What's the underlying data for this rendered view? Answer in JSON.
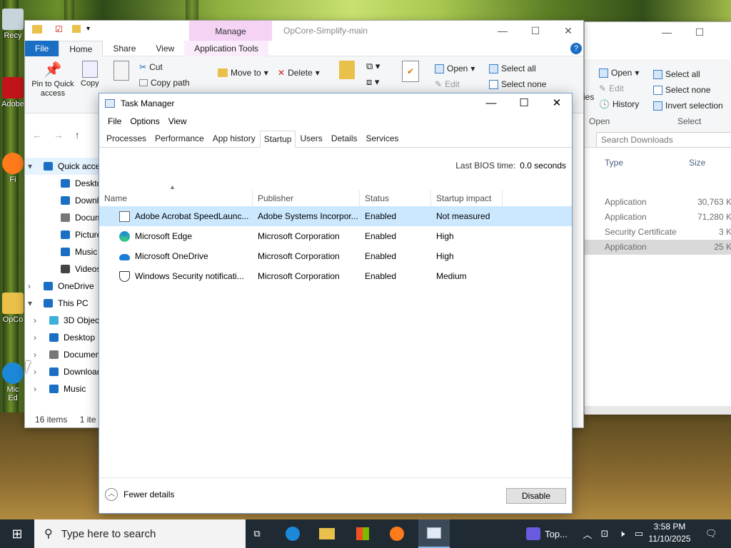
{
  "desktop": {
    "icons": [
      "Recy",
      "Adobe",
      "Fi",
      "OpCo",
      "Mic\nEd"
    ]
  },
  "explorer_main": {
    "title": "OpCore-Simplify-main",
    "context_tab": "Manage",
    "tabs": [
      "File",
      "Home",
      "Share",
      "View",
      "Application Tools"
    ],
    "ribbon": {
      "pin": "Pin to Quick access",
      "copy": "Copy",
      "paste": "Paste",
      "cut": "Cut",
      "copy_path": "Copy path",
      "move_to": "Move to",
      "delete": "Delete",
      "new": "New",
      "properties": "Properties",
      "open": "Open",
      "edit": "Edit",
      "select_all": "Select all",
      "select_none": "Select none"
    },
    "nav": {
      "quick_access": "Quick acce",
      "desktop": "Desktop",
      "downloads": "Downloa",
      "documents": "Documen",
      "pictures": "Pictures",
      "music": "Music",
      "videos": "Videos",
      "onedrive": "OneDrive",
      "this_pc": "This PC",
      "objects3d": "3D Object",
      "desktop2": "Desktop",
      "documents2": "Documen",
      "downloads2": "Download",
      "music2": "Music"
    },
    "status": {
      "items": "16 items",
      "selected": "1 ite"
    }
  },
  "explorer_right": {
    "ribbon": {
      "open": "Open",
      "edit": "Edit",
      "history": "History",
      "open_group": "Open",
      "select_all": "Select all",
      "select_none": "Select none",
      "invert": "Invert selection",
      "select_group": "Select",
      "ies": "ies"
    },
    "search_placeholder": "Search Downloads",
    "columns": {
      "type": "Type",
      "size": "Size"
    },
    "rows": [
      {
        "type": "Application",
        "size": "30,763 K"
      },
      {
        "type": "Application",
        "size": "71,280 K"
      },
      {
        "type": "Security Certificate",
        "size": "3 K"
      },
      {
        "type": "Application",
        "size": "25 K"
      }
    ]
  },
  "task_manager": {
    "title": "Task Manager",
    "menu": [
      "File",
      "Options",
      "View"
    ],
    "tabs": [
      "Processes",
      "Performance",
      "App history",
      "Startup",
      "Users",
      "Details",
      "Services"
    ],
    "active_tab": "Startup",
    "bios_label": "Last BIOS time:",
    "bios_value": "0.0 seconds",
    "columns": {
      "name": "Name",
      "publisher": "Publisher",
      "status": "Status",
      "impact": "Startup impact"
    },
    "rows": [
      {
        "name": "Adobe Acrobat SpeedLaunc...",
        "publisher": "Adobe Systems Incorpor...",
        "status": "Enabled",
        "impact": "Not measured",
        "icon": "acrobat-icon"
      },
      {
        "name": "Microsoft Edge",
        "publisher": "Microsoft Corporation",
        "status": "Enabled",
        "impact": "High",
        "icon": "edge-icon"
      },
      {
        "name": "Microsoft OneDrive",
        "publisher": "Microsoft Corporation",
        "status": "Enabled",
        "impact": "High",
        "icon": "onedrive-icon"
      },
      {
        "name": "Windows Security notificati...",
        "publisher": "Microsoft Corporation",
        "status": "Enabled",
        "impact": "Medium",
        "icon": "shield-icon"
      }
    ],
    "fewer_details": "Fewer details",
    "disable": "Disable"
  },
  "taskbar": {
    "search_placeholder": "Type here to search",
    "app_label": "Top...",
    "time": "3:58 PM",
    "date": "11/10/2025"
  }
}
